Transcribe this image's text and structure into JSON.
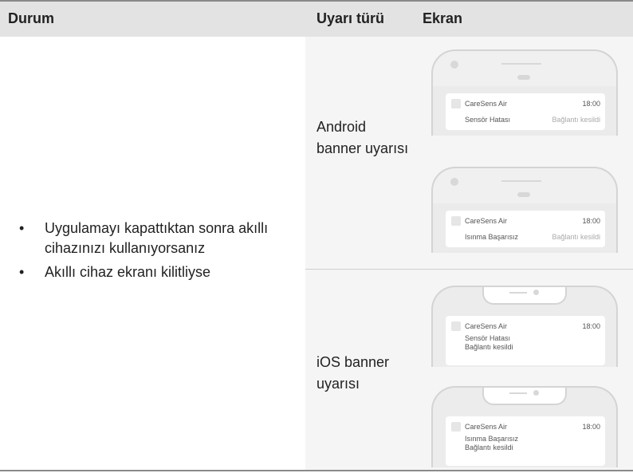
{
  "header": {
    "col1": "Durum",
    "col2": "Uyarı türü",
    "col3": "Ekran"
  },
  "conditions": [
    "Uygulamayı kapattıktan sonra akıllı cihazınızı kullanıyorsanız",
    "Akıllı cihaz ekranı kilitliyse"
  ],
  "types": {
    "android": "Android banner uyarısı",
    "ios": "iOS banner uyarısı"
  },
  "notifications": {
    "android_1": {
      "app": "CareSens Air",
      "time": "18:00",
      "message": "Sensör Hatası",
      "status": "Bağlantı kesildi"
    },
    "android_2": {
      "app": "CareSens Air",
      "time": "18:00",
      "message": "Isınma Başarısız",
      "status": "Bağlantı kesildi"
    },
    "ios_1": {
      "app": "CareSens Air",
      "time": "18:00",
      "message": "Sensör Hatası",
      "status": "Bağlantı kesildi"
    },
    "ios_2": {
      "app": "CareSens Air",
      "time": "18:00",
      "message": "Isınma Başarısız",
      "status": "Bağlantı kesildi"
    }
  }
}
